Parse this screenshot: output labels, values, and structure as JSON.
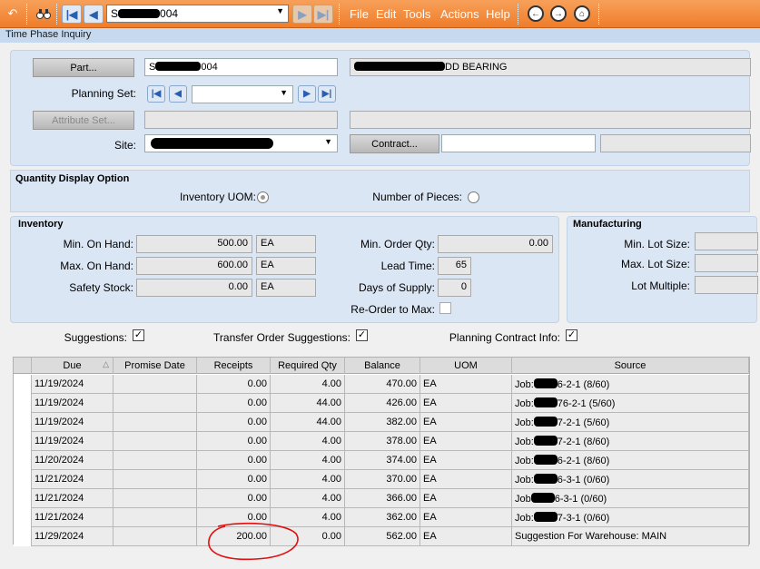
{
  "toolbar": {
    "part_combo_prefix": "S",
    "part_combo_suffix": "004",
    "menus": [
      "File",
      "Edit",
      "Tools",
      "Actions",
      "Help"
    ]
  },
  "window_title": "Time Phase Inquiry",
  "header": {
    "part_button": "Part...",
    "part_prefix": "S",
    "part_suffix": "004",
    "description_suffix": "DD BEARING",
    "planning_set_label": "Planning Set:",
    "attribute_set_button": "Attribute Set...",
    "site_label": "Site:",
    "contract_button": "Contract..."
  },
  "quantity_display": {
    "title": "Quantity Display Option",
    "inventory_uom_label": "Inventory UOM:",
    "number_of_pieces_label": "Number of Pieces:",
    "selected": "Inventory UOM"
  },
  "inventory": {
    "title": "Inventory",
    "min_on_hand_label": "Min. On Hand:",
    "min_on_hand": "500.00",
    "min_on_hand_uom": "EA",
    "max_on_hand_label": "Max. On Hand:",
    "max_on_hand": "600.00",
    "max_on_hand_uom": "EA",
    "safety_stock_label": "Safety Stock:",
    "safety_stock": "0.00",
    "safety_stock_uom": "EA",
    "min_order_qty_label": "Min. Order Qty:",
    "min_order_qty": "0.00",
    "lead_time_label": "Lead Time:",
    "lead_time": "65",
    "days_of_supply_label": "Days of Supply:",
    "days_of_supply": "0",
    "reorder_to_max_label": "Re-Order to Max:",
    "reorder_to_max": false
  },
  "manufacturing": {
    "title": "Manufacturing",
    "min_lot_size_label": "Min. Lot Size:",
    "max_lot_size_label": "Max. Lot Size:",
    "lot_multiple_label": "Lot Multiple:"
  },
  "options": {
    "suggestions_label": "Suggestions:",
    "suggestions": true,
    "transfer_label": "Transfer Order Suggestions:",
    "transfer": true,
    "planning_contract_label": "Planning Contract Info:",
    "planning_contract": true
  },
  "grid": {
    "columns": [
      "Due",
      "Promise Date",
      "Receipts",
      "Required Qty",
      "Balance",
      "UOM",
      "Source"
    ],
    "rows": [
      {
        "due": "11/19/2024",
        "promise": "",
        "receipts": "0.00",
        "required": "4.00",
        "balance": "470.00",
        "uom": "EA",
        "src_a": "Job:",
        "src_b": "6-2-1 (8/60)"
      },
      {
        "due": "11/19/2024",
        "promise": "",
        "receipts": "0.00",
        "required": "44.00",
        "balance": "426.00",
        "uom": "EA",
        "src_a": "Job:",
        "src_b": "76-2-1 (5/60)"
      },
      {
        "due": "11/19/2024",
        "promise": "",
        "receipts": "0.00",
        "required": "44.00",
        "balance": "382.00",
        "uom": "EA",
        "src_a": "Job:",
        "src_b": "7-2-1 (5/60)"
      },
      {
        "due": "11/19/2024",
        "promise": "",
        "receipts": "0.00",
        "required": "4.00",
        "balance": "378.00",
        "uom": "EA",
        "src_a": "Job:",
        "src_b": "7-2-1 (8/60)"
      },
      {
        "due": "11/20/2024",
        "promise": "",
        "receipts": "0.00",
        "required": "4.00",
        "balance": "374.00",
        "uom": "EA",
        "src_a": "Job:",
        "src_b": "6-2-1 (8/60)"
      },
      {
        "due": "11/21/2024",
        "promise": "",
        "receipts": "0.00",
        "required": "4.00",
        "balance": "370.00",
        "uom": "EA",
        "src_a": "Job:",
        "src_b": "6-3-1 (0/60)"
      },
      {
        "due": "11/21/2024",
        "promise": "",
        "receipts": "0.00",
        "required": "4.00",
        "balance": "366.00",
        "uom": "EA",
        "src_a": "Job",
        "src_b": "6-3-1 (0/60)"
      },
      {
        "due": "11/21/2024",
        "promise": "",
        "receipts": "0.00",
        "required": "4.00",
        "balance": "362.00",
        "uom": "EA",
        "src_a": "Job:",
        "src_b": "7-3-1 (0/60)"
      },
      {
        "due": "11/29/2024",
        "promise": "",
        "receipts": "200.00",
        "required": "0.00",
        "balance": "562.00",
        "uom": "EA",
        "src_a": "Suggestion For Warehouse: MAIN",
        "src_b": ""
      }
    ]
  },
  "colors": {
    "toolbar": "#ef7d2a",
    "panel": "#dbe6f5",
    "annotation": "#e01010"
  },
  "icons": [
    "undo-icon",
    "binoculars-icon",
    "first-record-icon",
    "previous-record-icon",
    "next-record-icon",
    "last-record-icon",
    "back-icon",
    "forward-icon",
    "home-icon",
    "dropdown-arrow-icon",
    "sort-ascending-icon"
  ]
}
